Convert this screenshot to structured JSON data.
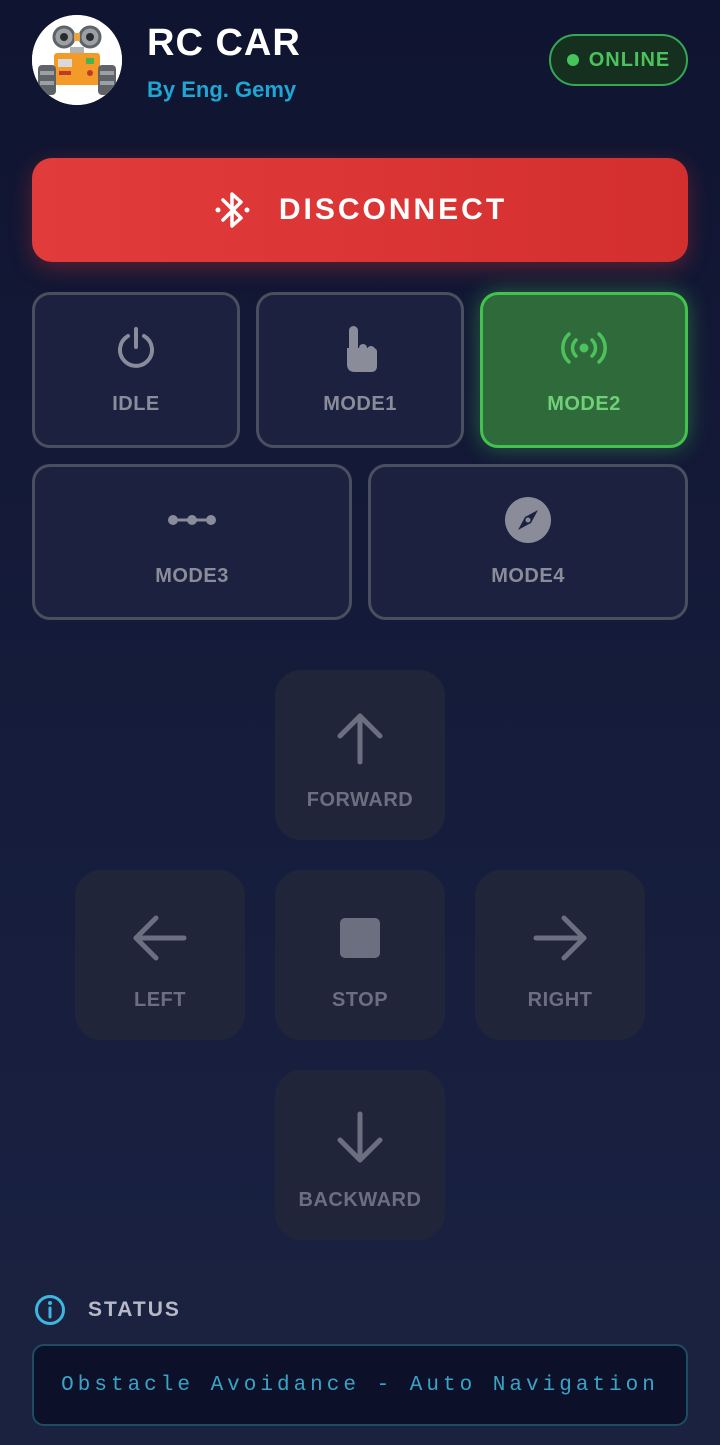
{
  "header": {
    "title": "RC CAR",
    "subtitle": "By Eng. Gemy",
    "status_badge": "ONLINE",
    "avatar_icon": "robot-avatar-icon"
  },
  "connection": {
    "button_label": "DISCONNECT",
    "icon": "bluetooth-icon"
  },
  "modes": [
    {
      "label": "IDLE",
      "icon": "power-icon",
      "active": false
    },
    {
      "label": "MODE1",
      "icon": "touch-icon",
      "active": false
    },
    {
      "label": "MODE2",
      "icon": "broadcast-icon",
      "active": true
    },
    {
      "label": "MODE3",
      "icon": "line-nodes-icon",
      "active": false
    },
    {
      "label": "MODE4",
      "icon": "compass-icon",
      "active": false
    }
  ],
  "controls": {
    "forward": "FORWARD",
    "left": "LEFT",
    "stop": "STOP",
    "right": "RIGHT",
    "backward": "BACKWARD"
  },
  "status": {
    "title": "STATUS",
    "message": "Obstacle Avoidance - Auto Navigation"
  },
  "colors": {
    "accent_green": "#44c24f",
    "disconnect_red": "#e23b3b",
    "subtitle_blue": "#1fa6d3",
    "status_cyan": "#3aa3c7"
  }
}
